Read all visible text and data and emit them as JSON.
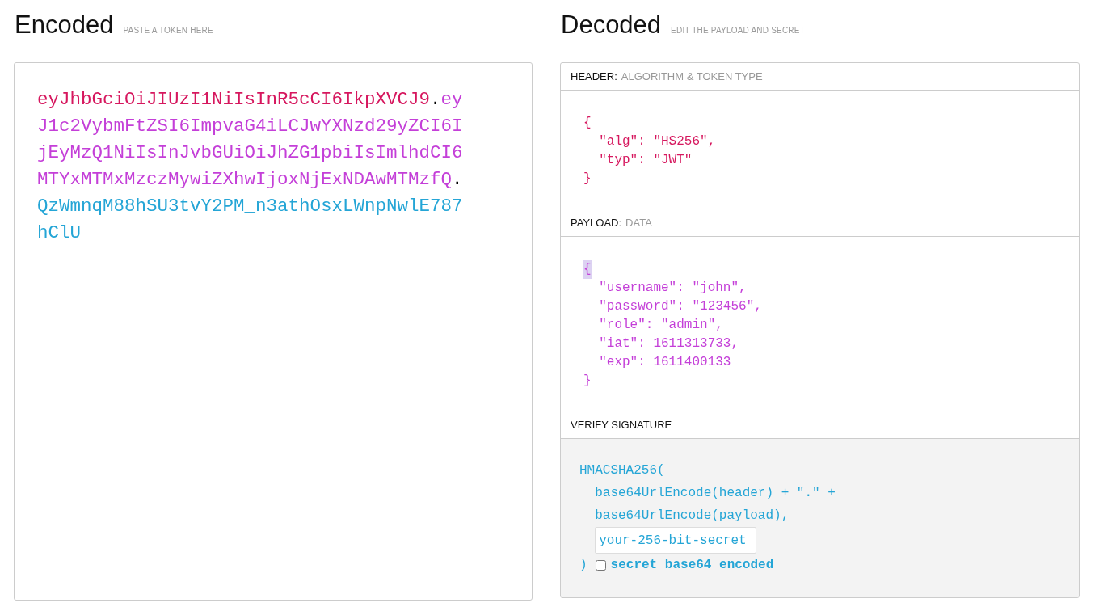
{
  "encoded": {
    "title": "Encoded",
    "subtitle": "PASTE A TOKEN HERE",
    "segments": [
      {
        "text": "eyJhbGciOiJIUzI1NiIsInR5cCI6IkpXVCJ9",
        "color": "#d6175e"
      },
      {
        "text": ".",
        "color": "#000000"
      },
      {
        "text": "eyJ1c2VybmFtZSI6ImpvaG4iLCJwYXNzd29yZCI6IjEyMzQ1NiIsInJvbGUiOiJhZG1pbiIsImlhdCI6MTYxMTMxMzczMywiZXhwIjoxNjExNDAwMTMzfQ",
        "color": "#c43fd8"
      },
      {
        "text": ".",
        "color": "#000000"
      },
      {
        "text": "QzWmnqM88hSU3tvY2PM_n3athOsxLWnpNwlE787hClU",
        "color": "#24a5d6"
      }
    ]
  },
  "decoded": {
    "title": "Decoded",
    "subtitle": "EDIT THE PAYLOAD AND SECRET",
    "sections": [
      {
        "kind": "json",
        "label": "HEADER:",
        "sublabel": "ALGORITHM & TOKEN TYPE",
        "color": "#d6175e",
        "open": "{",
        "open_highlighted": false,
        "entries": [
          "\"alg\": \"HS256\",",
          "\"typ\": \"JWT\""
        ],
        "close": "}"
      },
      {
        "kind": "json",
        "label": "PAYLOAD:",
        "sublabel": "DATA",
        "color": "#c43fd8",
        "open": "{",
        "open_highlighted": true,
        "entries": [
          "\"username\": \"john\",",
          "\"password\": \"123456\",",
          "\"role\": \"admin\",",
          "\"iat\": 1611313733,",
          "\"exp\": 1611400133"
        ],
        "close": "}"
      },
      {
        "kind": "signature",
        "label": "VERIFY SIGNATURE",
        "color": "#24a5d6",
        "function_open": "HMACSHA256(",
        "arguments": [
          "base64UrlEncode(header) + \".\" +",
          "base64UrlEncode(payload),"
        ],
        "secret_value": "your-256-bit-secret",
        "close": ")",
        "base64_option": {
          "label": "secret base64 encoded",
          "checked": false
        }
      }
    ]
  }
}
